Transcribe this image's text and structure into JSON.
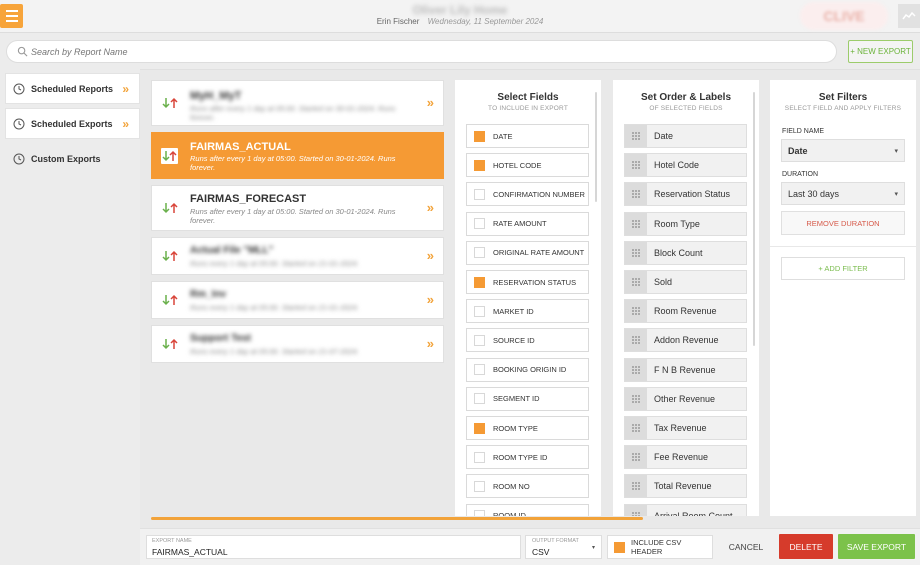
{
  "header": {
    "hotel_name": "Oliver Lily Home",
    "user_name": "Erin Fischer",
    "date": "Wednesday, 11 September 2024",
    "logo_text": "CLIVE"
  },
  "search": {
    "placeholder": "Search by Report Name",
    "value": ""
  },
  "new_export_label": "+ NEW EXPORT",
  "sidebar": {
    "items": [
      {
        "label": "Scheduled Reports",
        "chevron": "»"
      },
      {
        "label": "Scheduled Exports",
        "chevron": "»"
      },
      {
        "label": "Custom Exports"
      }
    ]
  },
  "reports": [
    {
      "name": "MyH_MyT",
      "desc": "Runs after every 1 day at 05:00. Started on 30-01-2024. Runs forever.",
      "chevron": "»"
    },
    {
      "name": "FAIRMAS_ACTUAL",
      "desc": "Runs after every 1 day at 05:00. Started on 30-01-2024. Runs forever.",
      "chevron": ""
    },
    {
      "name": "FAIRMAS_FORECAST",
      "desc": "Runs after every 1 day at 05:00. Started on 30-01-2024. Runs forever.",
      "chevron": "»"
    },
    {
      "name": "Actual File \"MLL\"",
      "desc": "Runs every 1 day at 05:00. Started on 21-01-2024.",
      "chevron": "»"
    },
    {
      "name": "Rm_Inv",
      "desc": "Runs every 1 day at 05:00. Started on 21-01-2024.",
      "chevron": "»"
    },
    {
      "name": "Support Test",
      "desc": "Runs every 1 day at 05:00. Started on 21-07-2024.",
      "chevron": "»"
    }
  ],
  "select_fields": {
    "title": "Select Fields",
    "subtitle": "TO INCLUDE IN EXPORT",
    "fields": [
      {
        "label": "DATE",
        "checked": true
      },
      {
        "label": "HOTEL CODE",
        "checked": true
      },
      {
        "label": "CONFIRMATION NUMBER",
        "checked": false
      },
      {
        "label": "RATE AMOUNT",
        "checked": false
      },
      {
        "label": "ORIGINAL RATE AMOUNT",
        "checked": false
      },
      {
        "label": "RESERVATION STATUS",
        "checked": true
      },
      {
        "label": "MARKET ID",
        "checked": false
      },
      {
        "label": "SOURCE ID",
        "checked": false
      },
      {
        "label": "BOOKING ORIGIN ID",
        "checked": false
      },
      {
        "label": "SEGMENT ID",
        "checked": false
      },
      {
        "label": "ROOM TYPE",
        "checked": true
      },
      {
        "label": "ROOM TYPE ID",
        "checked": false
      },
      {
        "label": "ROOM NO",
        "checked": false
      },
      {
        "label": "ROOM ID",
        "checked": false
      }
    ]
  },
  "order_labels": {
    "title": "Set Order & Labels",
    "subtitle": "OF SELECTED FIELDS",
    "items": [
      "Date",
      "Hotel Code",
      "Reservation Status",
      "Room Type",
      "Block Count",
      "Sold",
      "Room Revenue",
      "Addon Revenue",
      "F N B Revenue",
      "Other Revenue",
      "Tax Revenue",
      "Fee Revenue",
      "Total Revenue",
      "Arrival Room Count"
    ]
  },
  "filters": {
    "title": "Set Filters",
    "subtitle": "SELECT FIELD AND APPLY FILTERS",
    "field_name_label": "FIELD NAME",
    "field_name_value": "Date",
    "duration_label": "DURATION",
    "duration_value": "Last 30 days",
    "remove_label": "REMOVE DURATION",
    "add_label": "+ ADD FILTER"
  },
  "bottom": {
    "export_name_label": "EXPORT NAME",
    "export_name_value": "FAIRMAS_ACTUAL",
    "output_format_label": "OUTPUT FORMAT",
    "output_format_value": "CSV",
    "include_header_label": "INCLUDE CSV HEADER",
    "include_header_checked": true,
    "cancel_label": "CANCEL",
    "delete_label": "DELETE",
    "save_label": "SAVE EXPORT"
  },
  "colors": {
    "accent": "#f59a34",
    "green": "#7cc24a",
    "red": "#d63b2b"
  }
}
